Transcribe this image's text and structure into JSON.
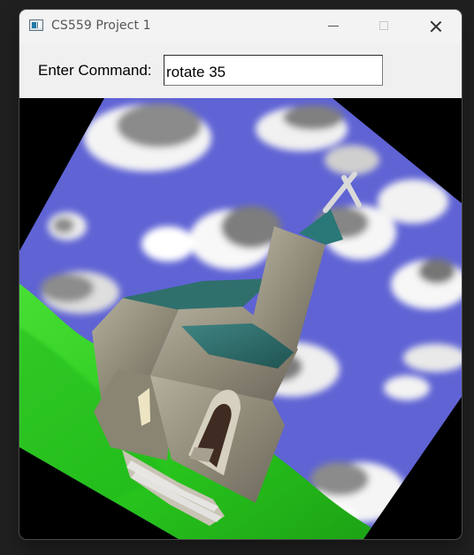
{
  "window": {
    "title": "CS559 Project 1",
    "controls": {
      "minimize_icon": "minimize-icon",
      "maximize_icon": "maximize-icon",
      "close_icon": "close-icon"
    }
  },
  "command": {
    "label": "Enter Command:",
    "value": "rotate 35"
  },
  "scene": {
    "subject": "church",
    "rotation_degrees": 35,
    "colors": {
      "sky": "#5f63d4",
      "grass": "#2ed11f",
      "roof": "#2f7674",
      "stone": "#9f9a88"
    }
  }
}
